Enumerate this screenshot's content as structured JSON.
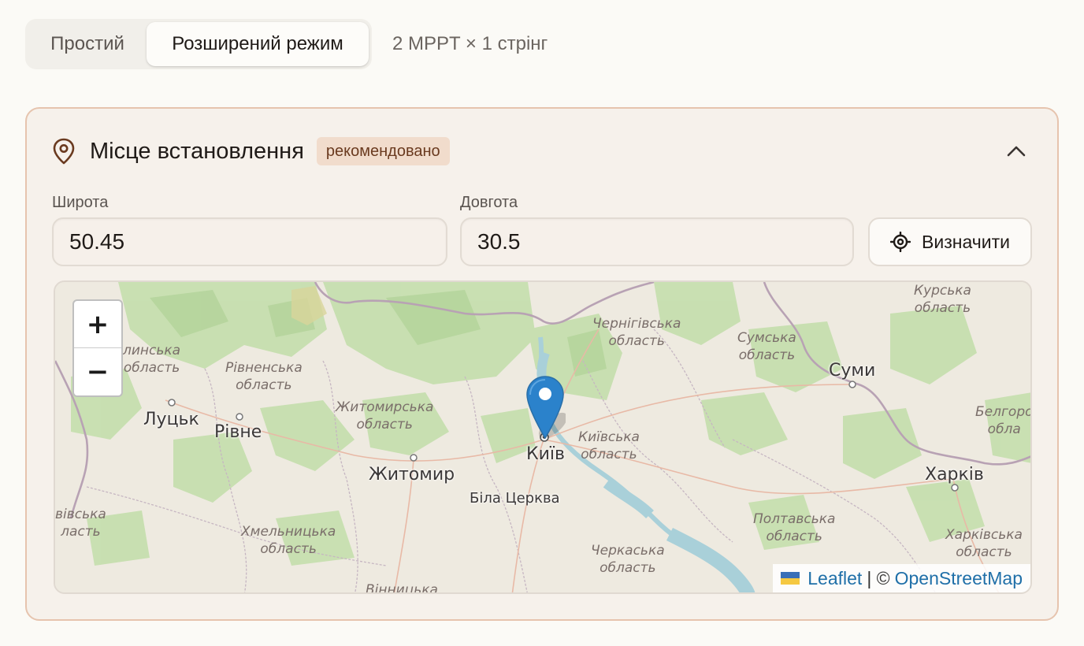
{
  "mode_switch": {
    "simple_label": "Простий",
    "advanced_label": "Розширений режим",
    "active": "advanced"
  },
  "config_summary": "2 MPPT × 1 стрінг",
  "location_card": {
    "title": "Місце встановлення",
    "badge": "рекомендовано",
    "latitude_label": "Широта",
    "latitude_value": "50.45",
    "longitude_label": "Довгота",
    "longitude_value": "30.5",
    "detect_button": "Визначити",
    "icons": {
      "title": "map-pin-icon",
      "collapse": "chevron-up-icon",
      "detect": "crosshair-icon"
    }
  },
  "map": {
    "zoom_in": "+",
    "zoom_out": "−",
    "attribution_leaflet": "Leaflet",
    "attribution_sep": "| ©",
    "attribution_osm": "OpenStreetMap",
    "labels": {
      "kursk": "Курська\nобласть",
      "chernihiv_obl": "Чернігівська\nобласть",
      "sumy_obl": "Сумська\nобласть",
      "volyn_obl": "линська\nобласть",
      "rivne_obl": "Рівненська\nобласть",
      "zhytomyr_obl": "Житомирська\nобласть",
      "kyiv_obl": "Київська\nобласть",
      "belgorod_obl": "Белгоро\nобла",
      "khmelnytskyi_obl": "Хмельницька\nобласть",
      "cherkasy_obl": "Черкаська\nобласть",
      "poltava_obl": "Полтавська\nобласть",
      "kharkiv_obl": "Харківська\nобласть",
      "lviv_obl": "вівська\nласть",
      "vinnytsia_obl": "Вінницька"
    },
    "cities": {
      "sumy": "Суми",
      "lutsk": "Луцьк",
      "rivne": "Рівне",
      "kyiv": "Київ",
      "zhytomyr": "Житомир",
      "bila_tserkva": "Біла Церква",
      "kharkiv": "Харків"
    }
  },
  "colors": {
    "card_bg": "#f6f1eb",
    "card_border": "#e6c4ae",
    "badge_bg": "#f1dccc",
    "marker": "#2b82cb",
    "link": "#1f6fa8"
  }
}
